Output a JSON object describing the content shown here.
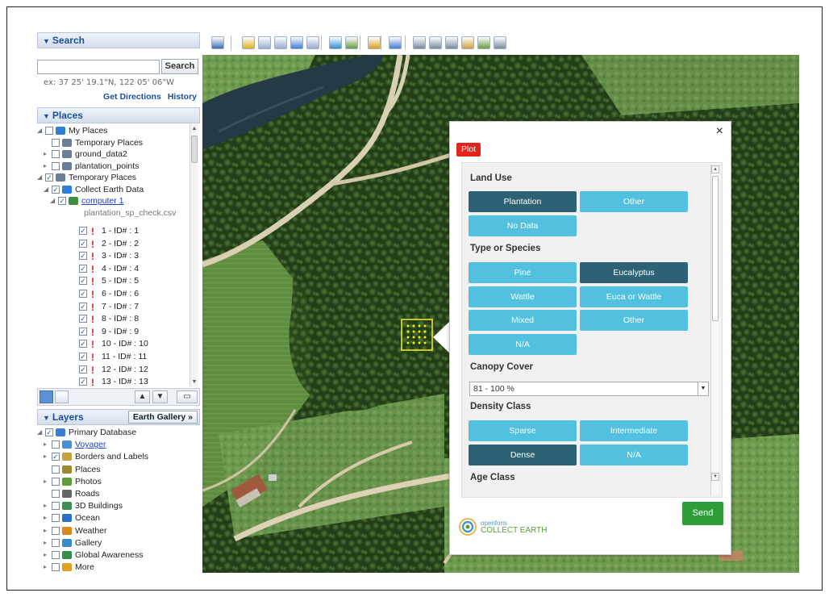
{
  "search": {
    "header": "Search",
    "button": "Search",
    "coords": "ex: 37 25' 19.1\"N, 122 05' 06\"W",
    "get_directions": "Get Directions",
    "history": "History"
  },
  "places": {
    "header": "Places",
    "items": [
      {
        "label": "My Places",
        "exp": "◢",
        "checked": false,
        "icon": "globe"
      },
      {
        "label": "Temporary Places",
        "exp": "",
        "checked": false,
        "icon": "folder"
      },
      {
        "label": "ground_data2",
        "exp": "▸",
        "checked": false,
        "icon": "folder"
      },
      {
        "label": "plantation_points",
        "exp": "▸",
        "checked": false,
        "icon": "folder"
      },
      {
        "label": "Temporary Places",
        "exp": "◢",
        "checked": true,
        "icon": "folder"
      },
      {
        "label": "Collect Earth Data",
        "exp": "◢",
        "checked": true,
        "icon": "globe"
      },
      {
        "label": "computer 1",
        "exp": "◢",
        "checked": true,
        "icon": "gear"
      },
      {
        "label": "plantation_sp_check.csv",
        "exp": "",
        "checked": null,
        "icon": ""
      }
    ],
    "points": [
      "1 - ID# : 1",
      "2 - ID# : 2",
      "3 - ID# : 3",
      "4 - ID# : 4",
      "5 - ID# : 5",
      "6 - ID# : 6",
      "7 - ID# : 7",
      "8 - ID# : 8",
      "9 - ID# : 9",
      "10 - ID# : 10",
      "11 - ID# : 11",
      "12 - ID# : 12",
      "13 - ID# : 13"
    ]
  },
  "layers": {
    "header": "Layers",
    "gallery_button": "Earth Gallery",
    "gallery_arrow": "»",
    "items": [
      {
        "label": "Primary Database",
        "exp": "◢",
        "checked": true,
        "color": "#3a7bd5"
      },
      {
        "label": "Voyager",
        "exp": "▸",
        "checked": false,
        "color": "#4a90d9",
        "link": true
      },
      {
        "label": "Borders and Labels",
        "exp": "▸",
        "checked": true,
        "color": "#c9a23c"
      },
      {
        "label": "Places",
        "exp": "",
        "checked": false,
        "color": "#9b8a2b"
      },
      {
        "label": "Photos",
        "exp": "▸",
        "checked": false,
        "color": "#5c9e3d"
      },
      {
        "label": "Roads",
        "exp": "",
        "checked": false,
        "color": "#666666"
      },
      {
        "label": "3D Buildings",
        "exp": "▸",
        "checked": false,
        "color": "#3f8f5b"
      },
      {
        "label": "Ocean",
        "exp": "▸",
        "checked": false,
        "color": "#2a6fc8"
      },
      {
        "label": "Weather",
        "exp": "▸",
        "checked": false,
        "color": "#d98a1d"
      },
      {
        "label": "Gallery",
        "exp": "▸",
        "checked": false,
        "color": "#3a8ad0"
      },
      {
        "label": "Global Awareness",
        "exp": "▸",
        "checked": false,
        "color": "#2f8f4a"
      },
      {
        "label": "More",
        "exp": "▸",
        "checked": false,
        "color": "#e0a020"
      }
    ]
  },
  "popup": {
    "close": "×",
    "tab": "Plot",
    "land_use": {
      "title": "Land Use",
      "options": [
        "Plantation",
        "Other",
        "No Data"
      ],
      "selected": "Plantation"
    },
    "species": {
      "title": "Type or Species",
      "options": [
        "Pine",
        "Eucalyptus",
        "Wattle",
        "Euca or Wattle",
        "Mixed",
        "Other",
        "N/A"
      ],
      "selected": "Eucalyptus"
    },
    "canopy": {
      "title": "Canopy Cover",
      "value": "81 - 100 %"
    },
    "density": {
      "title": "Density Class",
      "options": [
        "Sparse",
        "Intermediate",
        "Dense",
        "N/A"
      ],
      "selected": "Dense"
    },
    "age": {
      "title": "Age Class"
    },
    "logo_top": "openforis",
    "logo_bottom": "COLLECT EARTH",
    "send": "Send"
  },
  "colors": {
    "accent_blue": "#52c0df",
    "selected": "#2c6274",
    "plot_red": "#e3241a",
    "send_green": "#2f9e38"
  }
}
